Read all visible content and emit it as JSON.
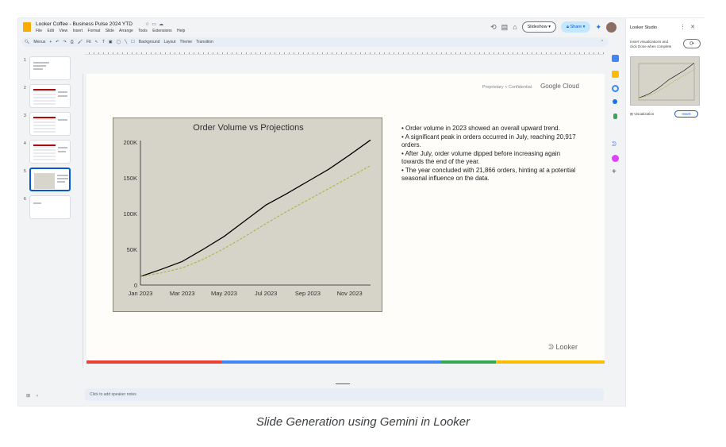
{
  "app": {
    "doc_title": "Looker Coffee - Business Pulse 2024 YTD",
    "menu": [
      "File",
      "Edit",
      "View",
      "Insert",
      "Format",
      "Slide",
      "Arrange",
      "Tools",
      "Extensions",
      "Help"
    ],
    "slideshow_label": "Slideshow",
    "share_label": "Share"
  },
  "toolbar": {
    "items": [
      "Menus",
      "Background",
      "Layout",
      "Theme",
      "Transition"
    ],
    "zoom_label": "Fit"
  },
  "filmstrip": {
    "slides": [
      {
        "num": "1",
        "type": "title"
      },
      {
        "num": "2",
        "type": "table"
      },
      {
        "num": "3",
        "type": "table"
      },
      {
        "num": "4",
        "type": "table"
      },
      {
        "num": "5",
        "type": "chart",
        "selected": true
      },
      {
        "num": "6",
        "type": "blank"
      }
    ]
  },
  "slide": {
    "header_note": "Proprietary + Confidential",
    "google_cloud": "Google Cloud",
    "looker_logo": "Looker",
    "bullets": [
      "Order volume in 2023 showed an overall upward trend.",
      "A significant peak in orders occurred in July, reaching 20,917 orders.",
      "After July, order volume dipped before increasing again towards the end of the year.",
      "The year concluded with 21,866 orders, hinting at a potential seasonal influence on the data."
    ],
    "brand_colors": [
      "#ea4335",
      "#4285f4",
      "#34a853",
      "#fbbc04"
    ]
  },
  "chart_data": {
    "type": "line",
    "title": "Order Volume vs Projections",
    "x": [
      "Jan 2023",
      "Feb 2023",
      "Mar 2023",
      "Apr 2023",
      "May 2023",
      "Jun 2023",
      "Jul 2023",
      "Aug 2023",
      "Sep 2023",
      "Oct 2023",
      "Nov 2023",
      "Dec 2023"
    ],
    "x_tick_labels": [
      "Jan 2023",
      "Mar 2023",
      "May 2023",
      "Jul 2023",
      "Sep 2023",
      "Nov 2023"
    ],
    "y_tick_labels": [
      "0",
      "50K",
      "100K",
      "150K",
      "200K"
    ],
    "ylim": [
      0,
      200000
    ],
    "series": [
      {
        "values": [
          12000,
          22000,
          33000,
          50000,
          68000,
          90000,
          112000,
          128000,
          145000,
          162000,
          182000,
          203000
        ],
        "color": "#000000",
        "style": "solid"
      },
      {
        "values": [
          12000,
          17000,
          24000,
          36000,
          51000,
          68000,
          86000,
          103000,
          119000,
          135000,
          151000,
          167000
        ],
        "color": "#9fb33c",
        "style": "dashed"
      }
    ]
  },
  "notes": {
    "placeholder": "Click to add speaker notes"
  },
  "panel": {
    "title": "Looker Studio",
    "description": "Insert visualizations and click Done when complete",
    "meta_label": "Visualization",
    "insert_label": "Insert"
  },
  "caption": "Slide Generation using Gemini in Looker"
}
